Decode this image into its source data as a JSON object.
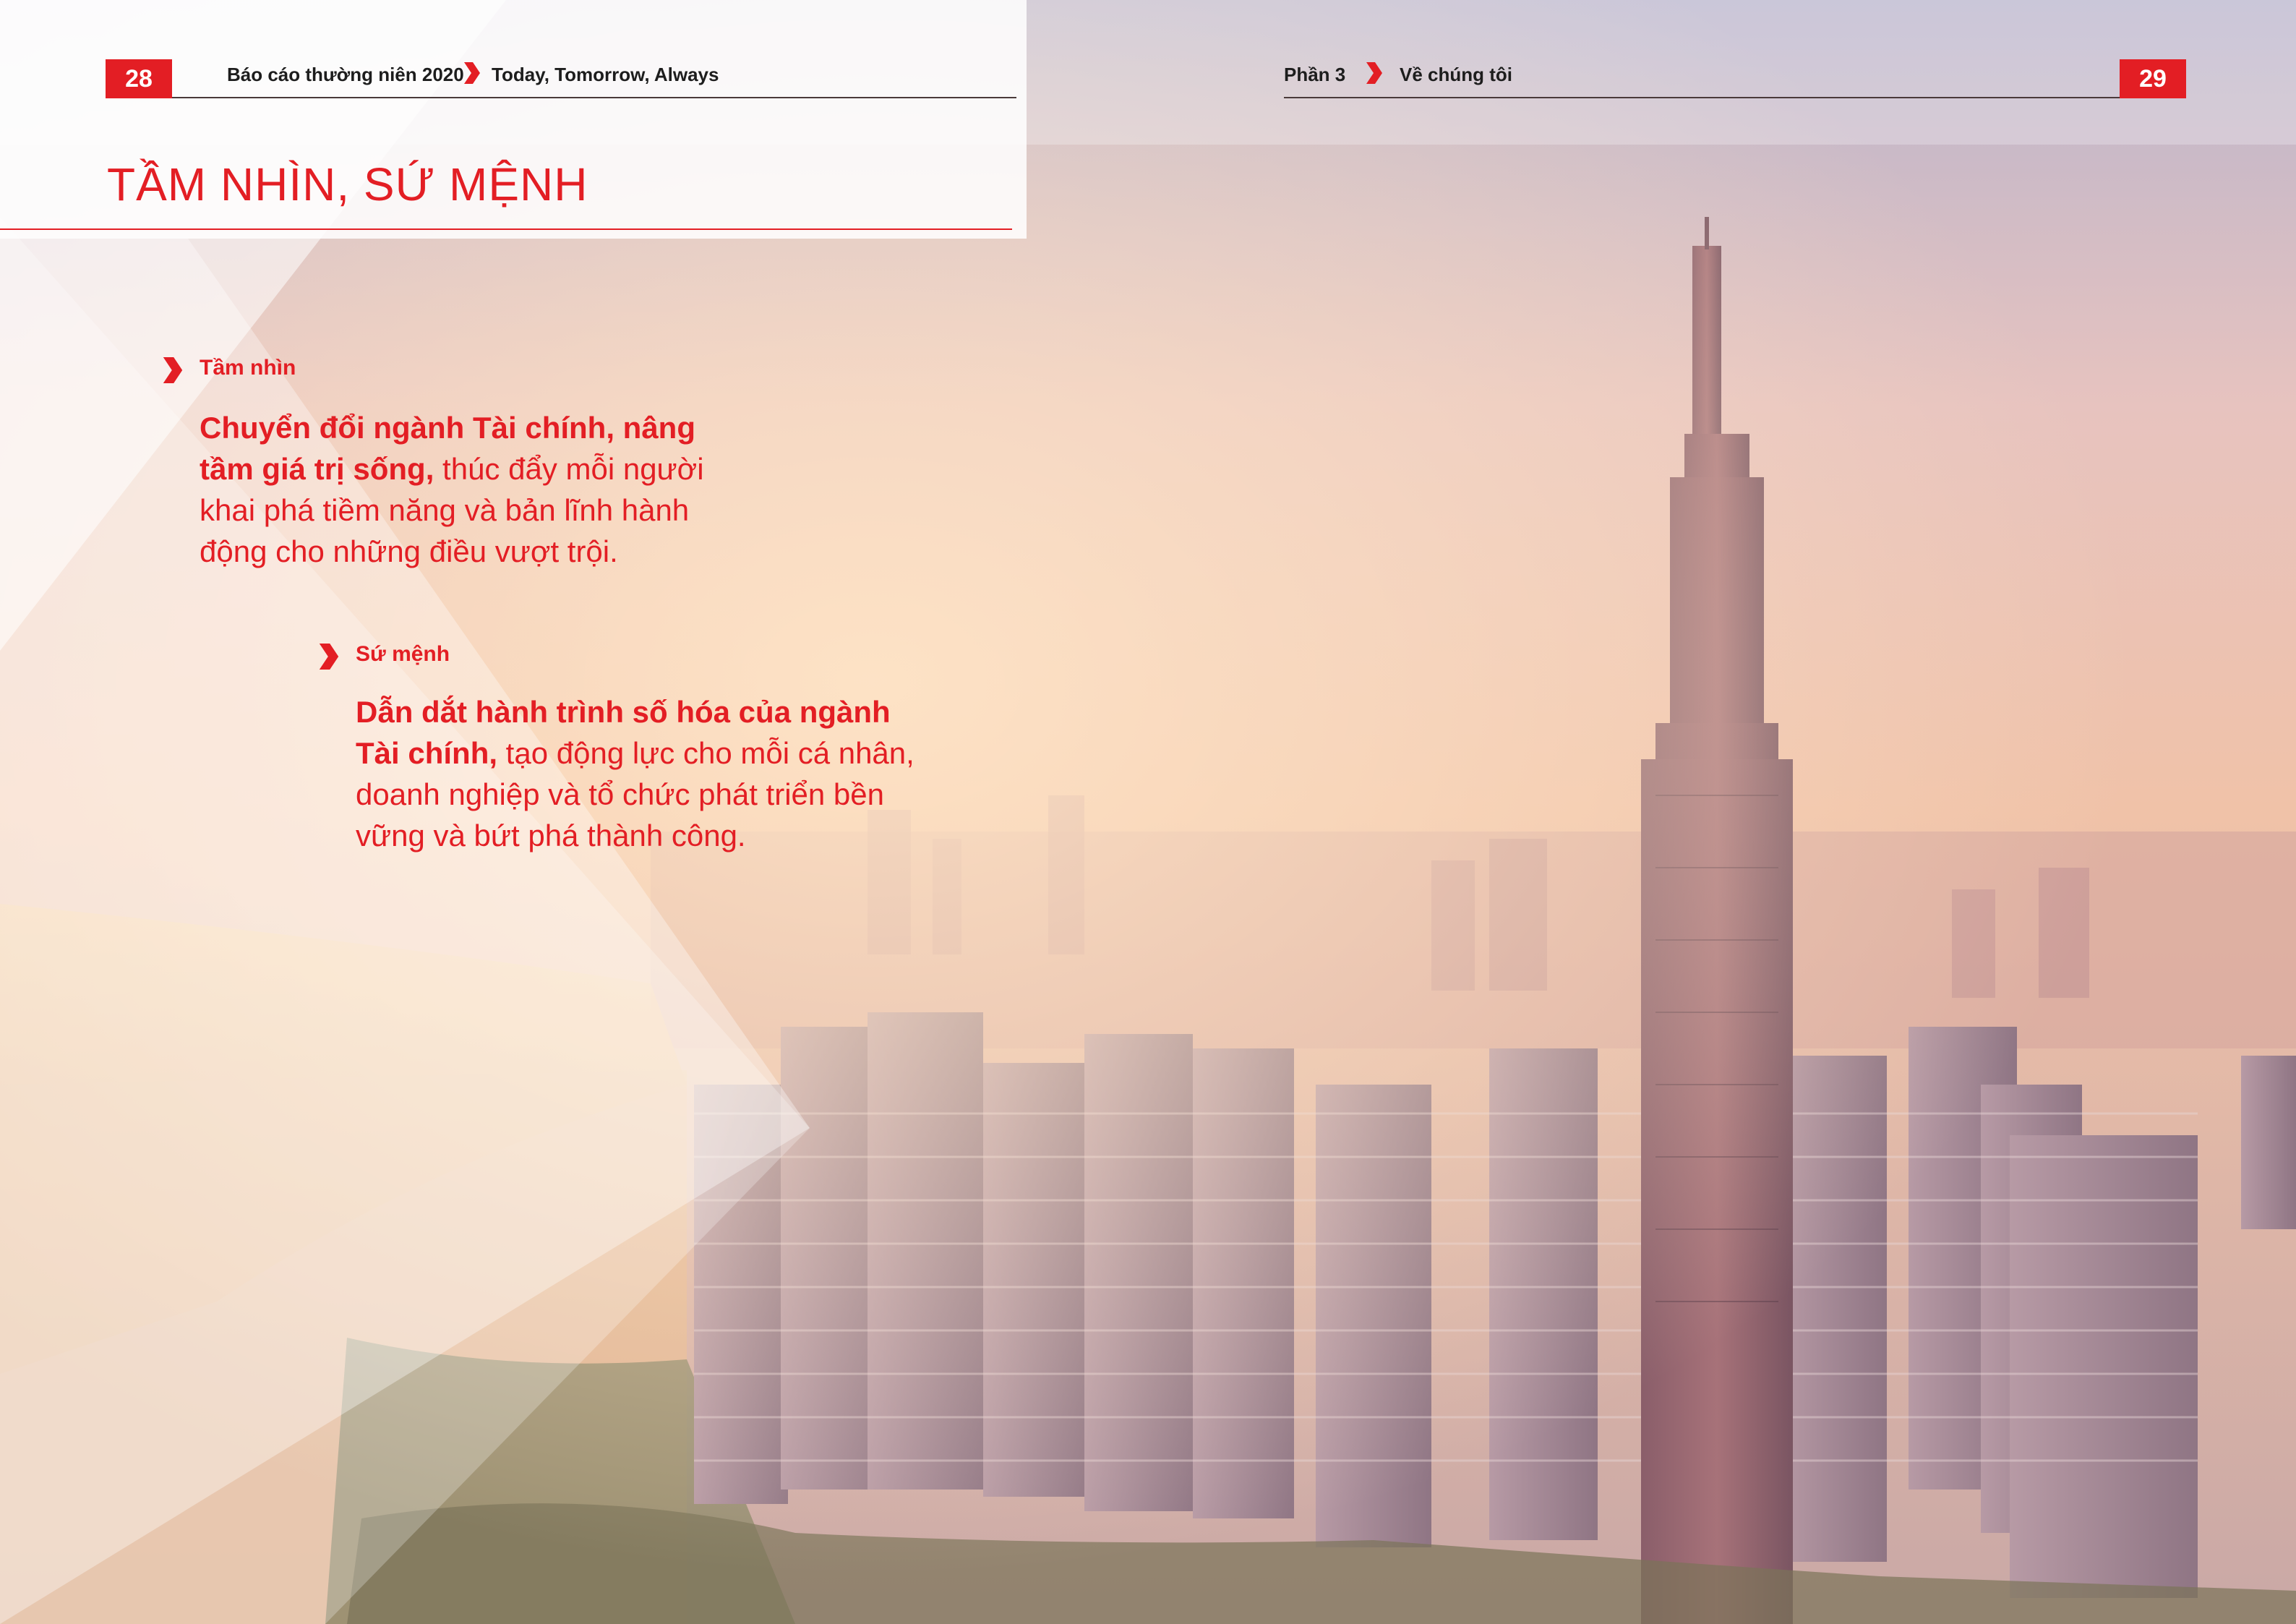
{
  "header_left": {
    "page_number": "28",
    "report_title": "Báo cáo thường niên 2020",
    "tagline": "Today, Tomorrow, Always"
  },
  "header_right": {
    "section": "Phần 3",
    "section_title": "Về chúng tôi",
    "page_number": "29"
  },
  "page_title": "TẦM NHÌN, SỨ MỆNH",
  "vision": {
    "label": "Tầm nhìn",
    "line1_bold": "Chuyển đổi ngành Tài chính, nâng",
    "line2_bold": "tầm giá trị sống,",
    "line2_rest": " thúc đẩy mỗi người",
    "line3": "khai phá tiềm năng và bản lĩnh hành",
    "line4": "động cho những điều vượt trội."
  },
  "mission": {
    "label": "Sứ mệnh",
    "line1_bold": "Dẫn dắt hành trình số hóa của ngành",
    "line2_bold": "Tài chính,",
    "line2_rest": " tạo động lực cho mỗi cá nhân,",
    "line3": "doanh nghiệp  và tổ chức phát triển bền",
    "line4": "vững và bứt phá thành công."
  },
  "colors": {
    "accent": "#e31e24",
    "text_dark": "#1d1d1d"
  }
}
